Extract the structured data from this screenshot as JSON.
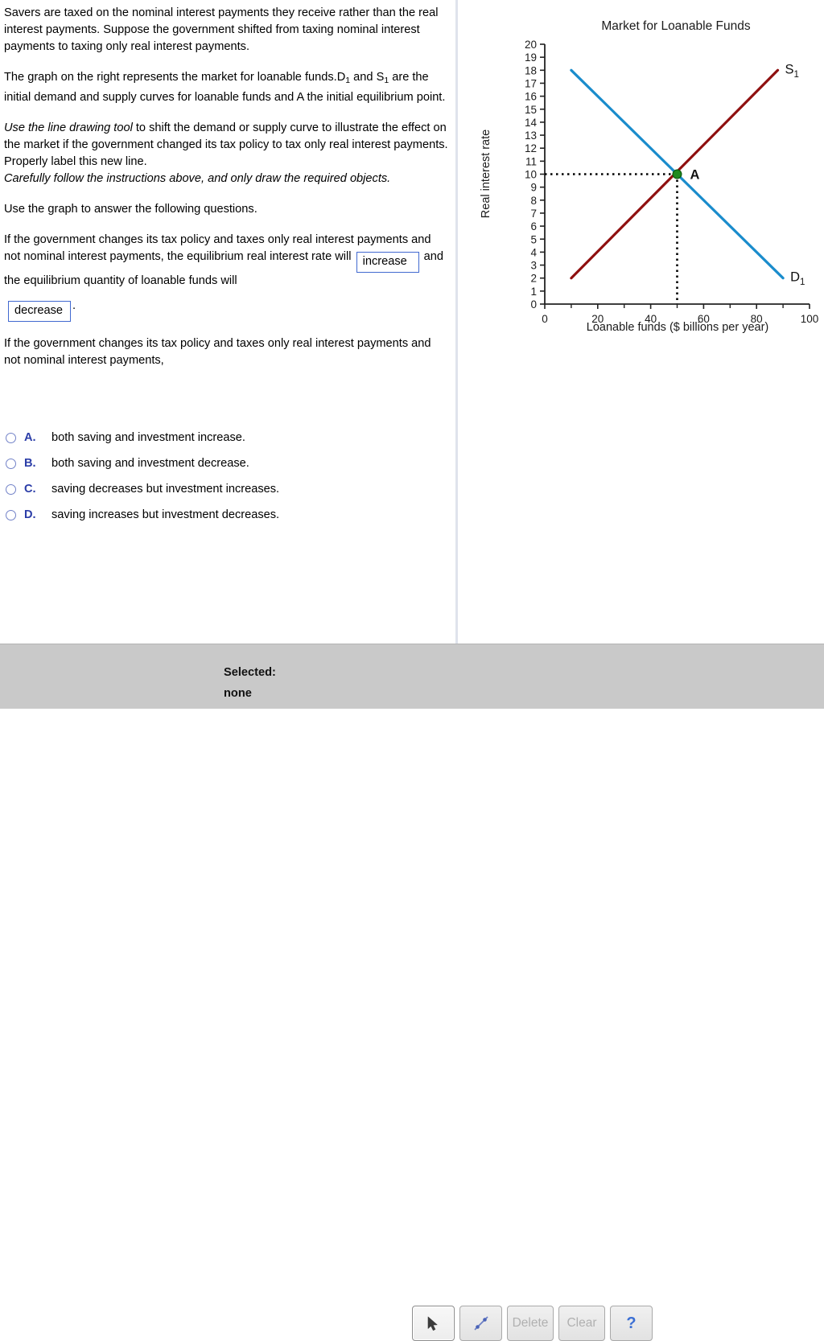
{
  "question": {
    "paragraphs": [
      "Savers are taxed on the nominal interest payments they receive rather than the real interest payments.  Suppose the government shifted from taxing nominal interest payments to taxing only real interest payments.",
      "Use the graph to answer the following questions."
    ],
    "p2_part1": "The graph on the right represents the market for loanable funds.D",
    "p2_sub1": "1",
    "p2_part2": " and S",
    "p2_sub2": "1",
    "p2_part3": " are the initial demand and supply curves  for loanable funds and A the initial equilibrium point.",
    "p3_italic": "Use the line drawing tool",
    "p3_rest": " to shift the demand or supply curve to illustrate the effect on the market if the government changed its tax policy to tax only real interest payments. Properly label this new line.",
    "p3_italic2": "Carefully follow the instructions above, and only draw the required objects.",
    "p4_part1": "If the government changes its tax policy and taxes only real interest payments and not nominal interest payments, the equilibrium real interest rate will ",
    "p4_part2": " and the equilibrium quantity of loanable funds will ",
    "p4_period": ".",
    "p5": "If the government changes its tax policy and taxes only real interest payments and not nominal interest payments,",
    "answer_rate": "increase",
    "answer_quantity": "decrease"
  },
  "choices": [
    {
      "letter": "A.",
      "text": "both saving and investment  increase."
    },
    {
      "letter": "B.",
      "text": "both saving and investment decrease."
    },
    {
      "letter": "C.",
      "text": "saving decreases but investment increases."
    },
    {
      "letter": "D.",
      "text": "saving increases but investment decreases."
    }
  ],
  "toolbar": {
    "selected_label": "Selected:",
    "selected_value": "none",
    "pointer_tool": "pointer-tool",
    "line_tool": "line-tool",
    "delete_label": "Delete",
    "clear_label": "Clear",
    "help_label": "?"
  },
  "chart_data": {
    "type": "line",
    "title": "Market for Loanable Funds",
    "xlabel": "Loanable funds ($ billions per year)",
    "ylabel": "Real interest rate",
    "xlim": [
      0,
      100
    ],
    "ylim": [
      0,
      20
    ],
    "xticks": [
      0,
      20,
      40,
      60,
      80,
      100
    ],
    "xtick_labels": [
      "0",
      "20",
      "40",
      "60",
      "80",
      "100"
    ],
    "yticks": [
      0,
      1,
      2,
      3,
      4,
      5,
      6,
      7,
      8,
      9,
      10,
      11,
      12,
      13,
      14,
      15,
      16,
      17,
      18,
      19,
      20
    ],
    "ytick_labels": [
      "0",
      "1",
      "2",
      "3",
      "4",
      "5",
      "6",
      "7",
      "8",
      "9",
      "10",
      "11",
      "12",
      "13",
      "14",
      "15",
      "16",
      "17",
      "18",
      "19",
      "20"
    ],
    "grid": false,
    "legend": "none",
    "series": [
      {
        "name": "D1",
        "label": "D",
        "label_sub": "1",
        "color": "#1a8ccc",
        "x": [
          10,
          90
        ],
        "y": [
          18,
          2
        ]
      },
      {
        "name": "S1",
        "label": "S",
        "label_sub": "1",
        "color": "#8f1010",
        "x": [
          10,
          88
        ],
        "y": [
          2,
          18
        ]
      }
    ],
    "annotations": [
      {
        "name": "equilibrium-point-A",
        "label": "A",
        "x": 50,
        "y": 10,
        "marker_color": "#1f8a1f",
        "marker_edge": "#0d5c0d",
        "guide_color": "#000000",
        "guide_style": "dotted"
      }
    ]
  }
}
